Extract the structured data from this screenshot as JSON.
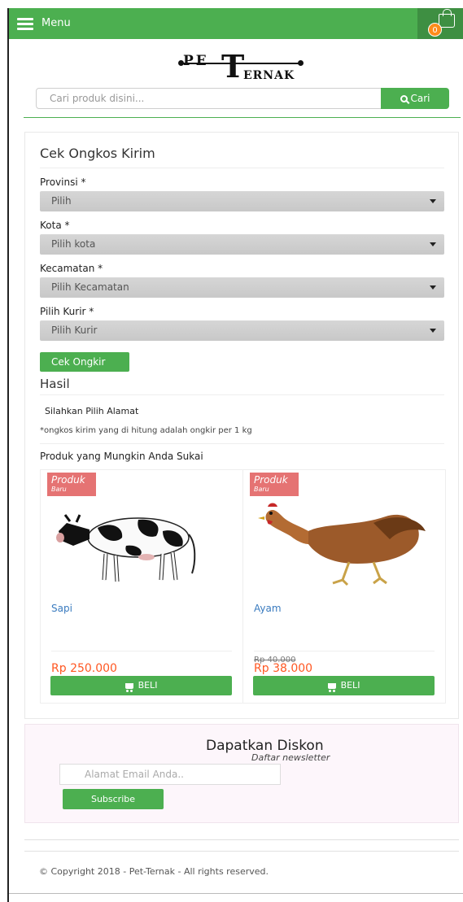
{
  "topbar": {
    "menu_label": "Menu",
    "cart_count": "0",
    "colors": {
      "bar": "#4caf50",
      "badge": "#ff8c1a"
    }
  },
  "logo": {
    "part1": "PE",
    "part2": "T",
    "part3": "ERNAK"
  },
  "search": {
    "placeholder": "Cari produk disini...",
    "button_label": "Cari"
  },
  "shipping": {
    "title": "Cek Ongkos Kirim",
    "fields": [
      {
        "label": "Provinsi *",
        "selected": "Pilih"
      },
      {
        "label": "Kota *",
        "selected": "Pilih kota"
      },
      {
        "label": "Kecamatan *",
        "selected": "Pilih Kecamatan"
      },
      {
        "label": "Pilih Kurir *",
        "selected": "Pilih Kurir"
      }
    ],
    "button_label": "Cek Ongkir",
    "result_title": "Hasil",
    "result_text": "Silahkan Pilih Alamat",
    "note": "*ongkos kirim yang di hitung adalah ongkir per 1 kg"
  },
  "recommend": {
    "title": "Produk yang Mungkin Anda Sukai",
    "badge_main": "Produk",
    "badge_sub": "Baru",
    "buy_label": "BELI",
    "products": [
      {
        "name": "Sapi",
        "price": "Rp 250.000",
        "old_price": ""
      },
      {
        "name": "Ayam",
        "price": "Rp 38.000",
        "old_price": "Rp 40.000"
      }
    ]
  },
  "newsletter": {
    "title": "Dapatkan Diskon",
    "subtitle": "Daftar newsletter",
    "placeholder": "Alamat Email Anda..",
    "button_label": "Subscribe"
  },
  "footer": {
    "copyright": "© Copyright 2018 - Pet-Ternak - All rights reserved."
  }
}
